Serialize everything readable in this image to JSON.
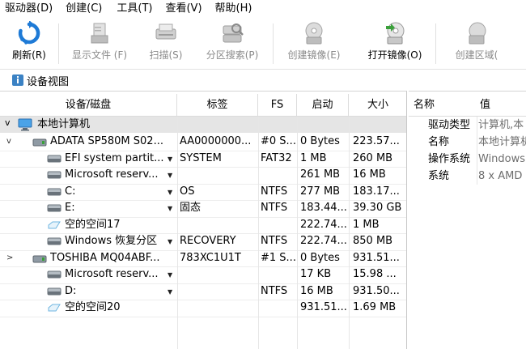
{
  "menu": [
    "驱动器(D)",
    "创建(C)",
    "工具(T)",
    "查看(V)",
    "帮助(H)"
  ],
  "toolbar": [
    {
      "label": "刷新(R)",
      "icon": "refresh-icon",
      "enabled": true
    },
    {
      "label": "显示文件 (F)",
      "icon": "show-files-icon",
      "enabled": false
    },
    {
      "label": "扫描(S)",
      "icon": "scan-icon",
      "enabled": false
    },
    {
      "label": "分区搜索(P)",
      "icon": "partition-search-icon",
      "enabled": false
    },
    {
      "label": "创建镜像(E)",
      "icon": "create-image-icon",
      "enabled": false
    },
    {
      "label": "打开镜像(O)",
      "icon": "open-image-icon",
      "enabled": true
    },
    {
      "label": "创建区域(",
      "icon": "create-region-icon",
      "enabled": false
    }
  ],
  "tab": {
    "label": "设备视图"
  },
  "grid": {
    "headers": [
      "设备/磁盘",
      "标签",
      "FS",
      "启动",
      "大小"
    ],
    "group": "本地计算机",
    "rows": [
      {
        "name": "ADATA SP580M S02...",
        "label": "AA0000000...",
        "fs": "#0 S...",
        "start": "0 Bytes",
        "size": "223.57...",
        "icon": "ssd-icon",
        "indent": 1,
        "expander": "v",
        "dropdown": false
      },
      {
        "name": "EFI system partit...",
        "label": "SYSTEM",
        "fs": "FAT32",
        "start": "1 MB",
        "size": "260 MB",
        "icon": "partition-icon",
        "indent": 2,
        "expander": "",
        "dropdown": true
      },
      {
        "name": "Microsoft reserv...",
        "label": "",
        "fs": "",
        "start": "261 MB",
        "size": "16 MB",
        "icon": "partition-icon",
        "indent": 2,
        "expander": "",
        "dropdown": true
      },
      {
        "name": "C:",
        "label": "OS",
        "fs": "NTFS",
        "start": "277 MB",
        "size": "183.17...",
        "icon": "partition-icon",
        "indent": 2,
        "expander": "",
        "dropdown": true
      },
      {
        "name": "E:",
        "label": "固态",
        "fs": "NTFS",
        "start": "183.44...",
        "size": "39.30 GB",
        "icon": "partition-icon",
        "indent": 2,
        "expander": "",
        "dropdown": true
      },
      {
        "name": "空的空间17",
        "label": "",
        "fs": "",
        "start": "222.74...",
        "size": "1 MB",
        "icon": "free-space-icon",
        "indent": 2,
        "expander": "",
        "dropdown": false
      },
      {
        "name": "Windows 恢复分区",
        "label": "RECOVERY",
        "fs": "NTFS",
        "start": "222.74...",
        "size": "850 MB",
        "icon": "partition-icon",
        "indent": 2,
        "expander": "",
        "dropdown": true
      },
      {
        "name": "TOSHIBA MQ04ABF...",
        "label": "783XC1U1T",
        "fs": "#1 S...",
        "start": "0 Bytes",
        "size": "931.51...",
        "icon": "hdd-icon",
        "indent": 1,
        "expander": ">",
        "dropdown": false
      },
      {
        "name": "Microsoft reserv...",
        "label": "",
        "fs": "",
        "start": "17 KB",
        "size": "15.98 ...",
        "icon": "partition-icon",
        "indent": 2,
        "expander": "",
        "dropdown": true
      },
      {
        "name": "D:",
        "label": "",
        "fs": "NTFS",
        "start": "16 MB",
        "size": "931.50...",
        "icon": "partition-icon",
        "indent": 2,
        "expander": "",
        "dropdown": true
      },
      {
        "name": "空的空间20",
        "label": "",
        "fs": "",
        "start": "931.51...",
        "size": "1.69 MB",
        "icon": "free-space-icon",
        "indent": 2,
        "expander": "",
        "dropdown": false
      }
    ]
  },
  "properties": {
    "headers": [
      "名称",
      "值"
    ],
    "rows": [
      {
        "name": "驱动类型",
        "value": "计算机,本"
      },
      {
        "name": "名称",
        "value": "本地计算机"
      },
      {
        "name": "操作系统",
        "value": "Windows"
      },
      {
        "name": "系统",
        "value": "8 x AMD"
      }
    ]
  },
  "colors": {
    "accent_blue": "#1e7ad6",
    "disabled_text": "#8a8a8a",
    "group_bg": "#e5e5e5",
    "value_text": "#6e6e6e"
  }
}
